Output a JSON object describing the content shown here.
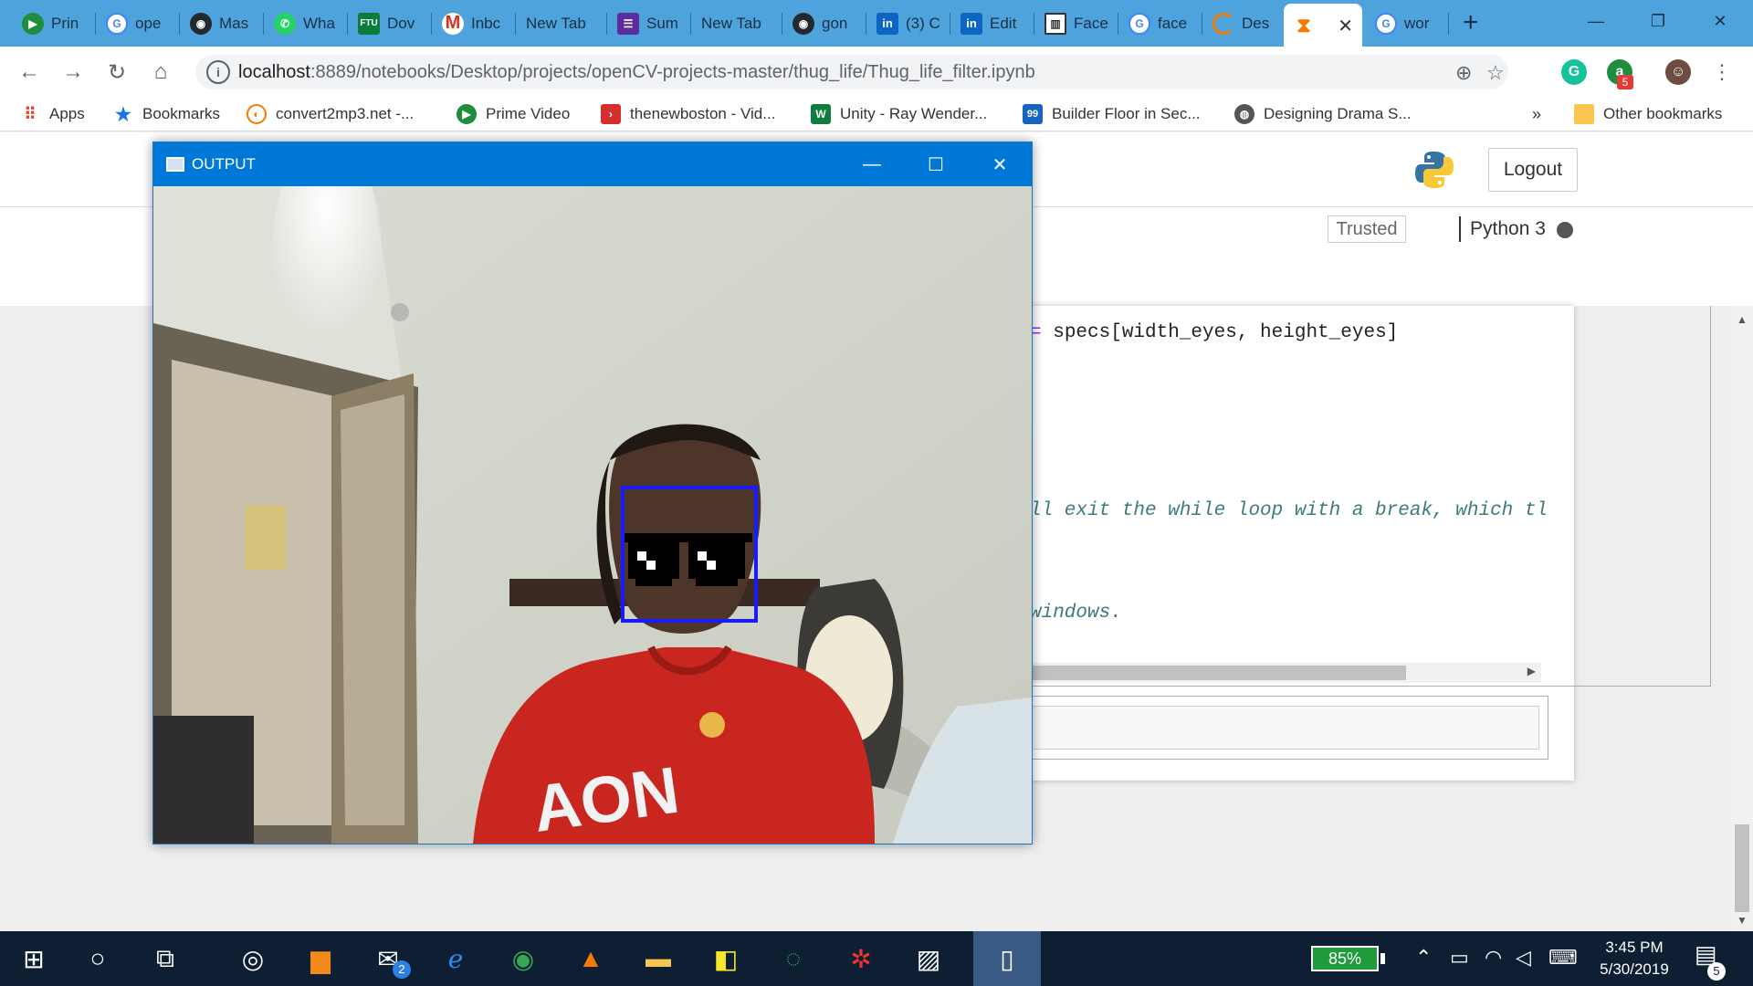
{
  "browser": {
    "tabs": [
      {
        "label": "Prin",
        "icon": "play-icon",
        "color": "#1e8e3e"
      },
      {
        "label": "ope",
        "icon": "google-icon",
        "color": "#4285f4"
      },
      {
        "label": "Mas",
        "icon": "github-icon",
        "color": "#24292e"
      },
      {
        "label": "Wha",
        "icon": "whatsapp-icon",
        "color": "#25d366"
      },
      {
        "label": "Dov",
        "icon": "ftu-icon",
        "color": "#0a7d3b"
      },
      {
        "label": "Inbc",
        "icon": "gmail-icon",
        "color": "#d93025"
      },
      {
        "label": "New Tab",
        "icon": "",
        "color": ""
      },
      {
        "label": "Sum",
        "icon": "list-icon",
        "color": "#5b2ca0"
      },
      {
        "label": "New Tab",
        "icon": "",
        "color": ""
      },
      {
        "label": "gon",
        "icon": "github-icon",
        "color": "#24292e"
      },
      {
        "label": "(3) C",
        "icon": "linkedin-icon",
        "color": "#0a66c2"
      },
      {
        "label": "Edit",
        "icon": "linkedin-icon",
        "color": "#0a66c2"
      },
      {
        "label": "Face",
        "icon": "window-icon",
        "color": "#333333"
      },
      {
        "label": "face",
        "icon": "google-icon",
        "color": "#4285f4"
      },
      {
        "label": "Des",
        "icon": "loading-icon",
        "color": "#f57c00"
      },
      {
        "label": "",
        "icon": "hourglass-icon",
        "color": "#f57c00"
      },
      {
        "label": "wor",
        "icon": "google-icon",
        "color": "#4285f4"
      }
    ],
    "active_tab_index": 15,
    "address": {
      "host": "localhost",
      "path": ":8889/notebooks/Desktop/projects/openCV-projects-master/thug_life/Thug_life_filter.ipynb"
    },
    "extension_badge": "5",
    "bookmarks": [
      {
        "label": "Apps",
        "icon": "apps-grid-icon",
        "color": "#ea4335"
      },
      {
        "label": "Bookmarks",
        "icon": "star-icon",
        "color": "#1a73e8"
      },
      {
        "label": "convert2mp3.net -...",
        "icon": "convert-icon",
        "color": "#f57c00"
      },
      {
        "label": "Prime Video",
        "icon": "play-icon",
        "color": "#1e8e3e"
      },
      {
        "label": "thenewboston - Vid...",
        "icon": "tnb-icon",
        "color": "#d32f2f"
      },
      {
        "label": "Unity - Ray Wender...",
        "icon": "rw-icon",
        "color": "#0f7d3b"
      },
      {
        "label": "Builder Floor in Sec...",
        "icon": "99-icon",
        "color": "#1565c0"
      },
      {
        "label": "Designing Drama S...",
        "icon": "globe-icon",
        "color": "#555555"
      }
    ],
    "overflow_label": "»",
    "other_bookmarks": "Other bookmarks"
  },
  "jupyter": {
    "logout_label": "Logout",
    "trusted_label": "Trusted",
    "kernel_label": "Python 3",
    "code_lines": [
      {
        "text": "= specs[width_eyes, height_eyes]",
        "kind": "code"
      },
      {
        "text": "ll exit the while loop with a break, which tl",
        "kind": "comment"
      },
      {
        "text": " windows.",
        "kind": "comment"
      }
    ]
  },
  "output_window": {
    "title": "OUTPUT",
    "shirt_text": "AON"
  },
  "taskbar": {
    "battery": "85%",
    "time": "3:45 PM",
    "date": "5/30/2019",
    "mail_badge": "2",
    "notification_badge": "5"
  }
}
